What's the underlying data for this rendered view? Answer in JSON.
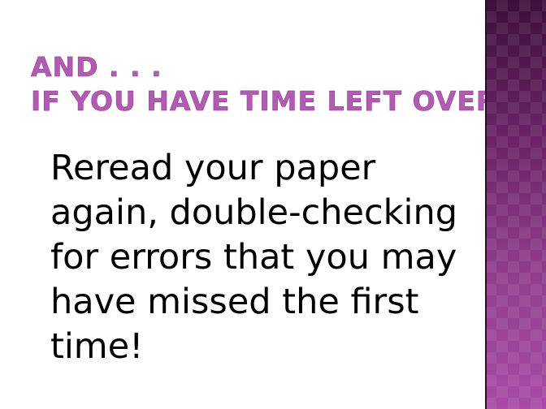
{
  "slide": {
    "title_lines": [
      "AND . . .",
      "IF YOU HAVE TIME LEFT OVER:"
    ],
    "body_lines": [
      "Reread your paper",
      "again, double-checking",
      "for errors that you may",
      "have missed the first",
      "time!"
    ]
  },
  "colors": {
    "title": "#b45ab4",
    "side_band_top": "#3d0f3a",
    "side_band_bottom": "#a84aa6",
    "body_text": "#000000",
    "background": "#ffffff"
  }
}
